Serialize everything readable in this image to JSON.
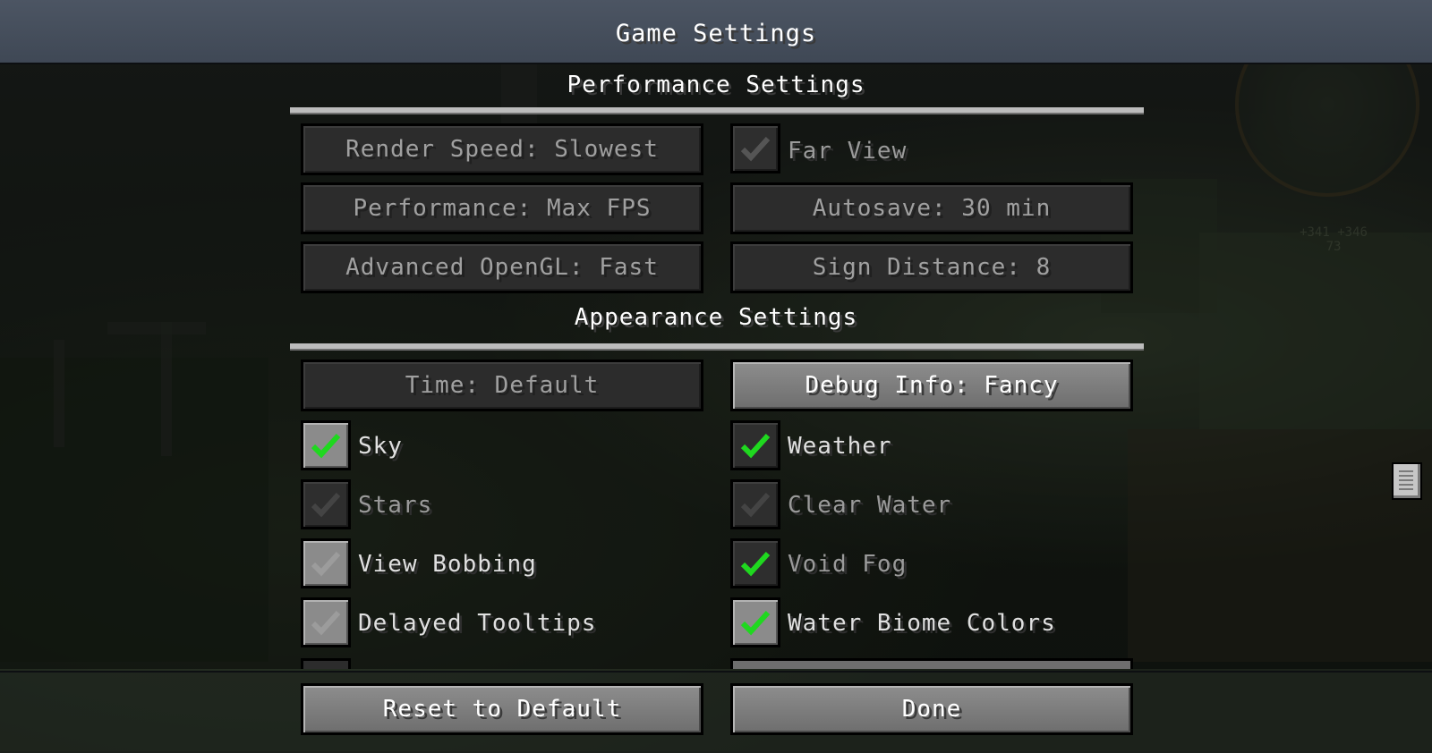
{
  "screen": {
    "title": "Game Settings"
  },
  "performance_section": {
    "title": "Performance Settings",
    "left_buttons": [
      {
        "label": "Render Speed: Slowest"
      },
      {
        "label": "Performance: Max FPS"
      },
      {
        "label": "Advanced OpenGL: Fast"
      }
    ],
    "far_view": {
      "label": "Far View",
      "checked": true,
      "enabled": false
    },
    "right_buttons": [
      {
        "label": "Autosave: 30 min"
      },
      {
        "label": "Sign Distance: 8"
      }
    ]
  },
  "appearance_section": {
    "title": "Appearance Settings",
    "time_button": {
      "label": "Time: Default"
    },
    "debug_button": {
      "label": "Debug Info: Fancy"
    },
    "left_checks": [
      {
        "label": "Sky",
        "checked": true
      },
      {
        "label": "Stars",
        "checked": false
      },
      {
        "label": "View Bobbing",
        "checked": false
      },
      {
        "label": "Delayed Tooltips",
        "checked": false
      }
    ],
    "right_checks": [
      {
        "label": "Weather",
        "checked": true
      },
      {
        "label": "Clear Water",
        "checked": false
      },
      {
        "label": "Void Fog",
        "checked": true
      },
      {
        "label": "Water Biome Colors",
        "checked": true
      }
    ]
  },
  "footer": {
    "reset_label": "Reset to Default",
    "done_label": "Done"
  },
  "hud": {
    "coords_line1": "+341 +346",
    "coords_line2": "73"
  },
  "colors": {
    "check_green": "#1fd81f",
    "check_gray": "#7a7a7a"
  }
}
